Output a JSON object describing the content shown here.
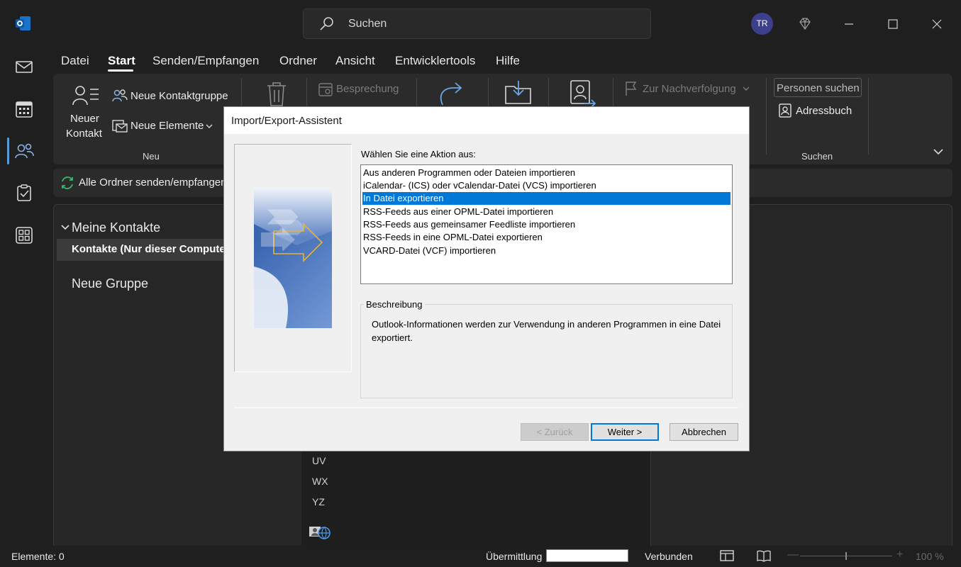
{
  "search": {
    "placeholder": "Suchen"
  },
  "account": {
    "initials": "TR"
  },
  "menu": [
    "Datei",
    "Start",
    "Senden/Empfangen",
    "Ordner",
    "Ansicht",
    "Entwicklertools",
    "Hilfe"
  ],
  "ribbon": {
    "new_contact": "Neuer",
    "new_contact_2": "Kontakt",
    "new_contact_group": "Neue Kontaktgruppe",
    "new_items": "Neue Elemente",
    "group_new": "Neu",
    "meeting": "Besprechung",
    "follow_up": "Zur Nachverfolgung",
    "find_people": "Personen suchen",
    "address_book": "Adressbuch",
    "group_find": "Suchen"
  },
  "subbar": {
    "send_receive_all": "Alle Ordner senden/empfangen"
  },
  "folders": {
    "my_contacts": "Meine Kontakte",
    "contacts": "Kontakte (Nur dieser Computer)",
    "new_group": "Neue Gruppe"
  },
  "letters": [
    "UV",
    "WX",
    "YZ"
  ],
  "status": {
    "items": "Elemente: 0",
    "transfer": "Übermittlung",
    "connected": "Verbunden",
    "zoom": "100 %"
  },
  "dialog": {
    "title": "Import/Export-Assistent",
    "prompt": "Wählen Sie eine Aktion aus:",
    "actions": [
      "Aus anderen Programmen oder Dateien importieren",
      "iCalendar- (ICS) oder vCalendar-Datei (VCS) importieren",
      "In Datei exportieren",
      "RSS-Feeds aus einer OPML-Datei importieren",
      "RSS-Feeds aus gemeinsamer Feedliste importieren",
      "RSS-Feeds in eine OPML-Datei exportieren",
      "VCARD-Datei (VCF) importieren"
    ],
    "selected_index": 2,
    "description_label": "Beschreibung",
    "description": "Outlook-Informationen werden zur Verwendung in anderen Programmen in eine Datei exportiert.",
    "back_button": "< Zurück",
    "next_button": "Weiter >",
    "cancel_button": "Abbrechen"
  },
  "colors": {
    "accent": "#0078d7",
    "app_bg": "#1f1f1f",
    "ribbon_bg": "#2b2b2b",
    "avatar": "#3c3f8a"
  }
}
